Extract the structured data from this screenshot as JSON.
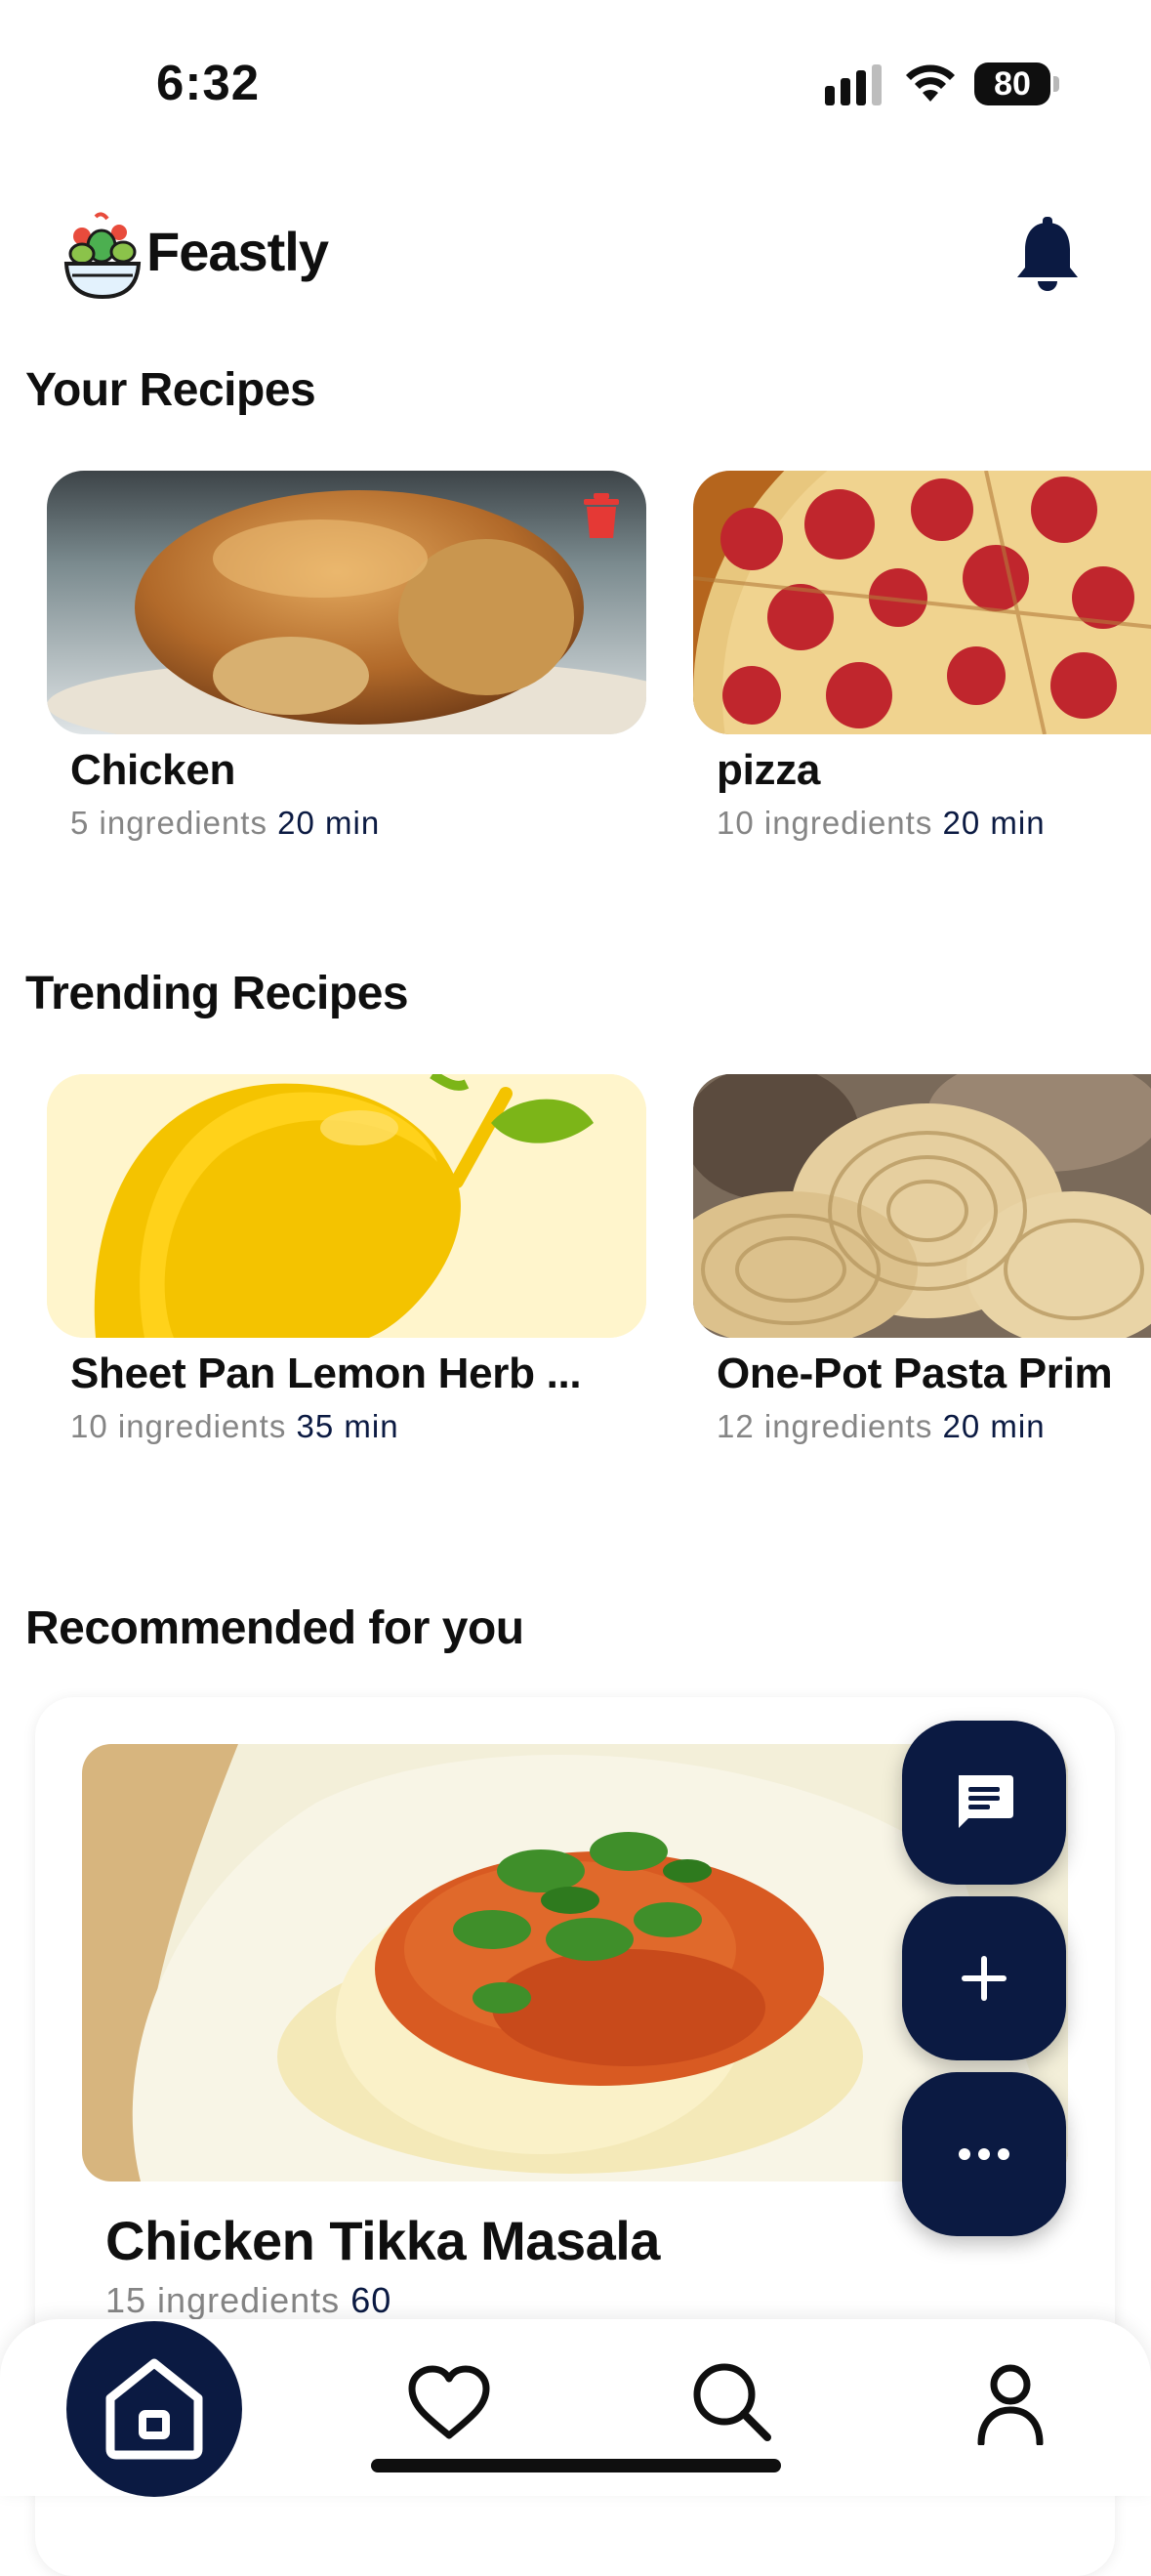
{
  "status_bar": {
    "time": "6:32",
    "battery": "80"
  },
  "header": {
    "app_name": "Feastly"
  },
  "your_recipes": {
    "title": "Your Recipes",
    "items": [
      {
        "name": "Chicken",
        "ingredients": "5 ingredients",
        "time": "20 min"
      },
      {
        "name": "pizza",
        "ingredients": "10 ingredients",
        "time": "20 min"
      }
    ]
  },
  "trending": {
    "title": "Trending Recipes",
    "items": [
      {
        "name": "Sheet Pan Lemon Herb ...",
        "ingredients": "10 ingredients",
        "time": "35 min"
      },
      {
        "name": "One-Pot Pasta Prim",
        "ingredients": "12 ingredients",
        "time": "20 min"
      }
    ]
  },
  "recommended": {
    "title": "Recommended for you",
    "item": {
      "name": "Chicken Tikka Masala",
      "ingredients": "15 ingredients",
      "time": "60"
    }
  },
  "colors": {
    "accent": "#0b1a42",
    "delete": "#e53935",
    "lemon_bg": "#fff5cc"
  },
  "icons": [
    "signal-icon",
    "wifi-icon",
    "bell-icon",
    "trash-icon",
    "chat-icon",
    "plus-icon",
    "more-icon",
    "home-icon",
    "heart-icon",
    "search-icon",
    "profile-icon"
  ]
}
